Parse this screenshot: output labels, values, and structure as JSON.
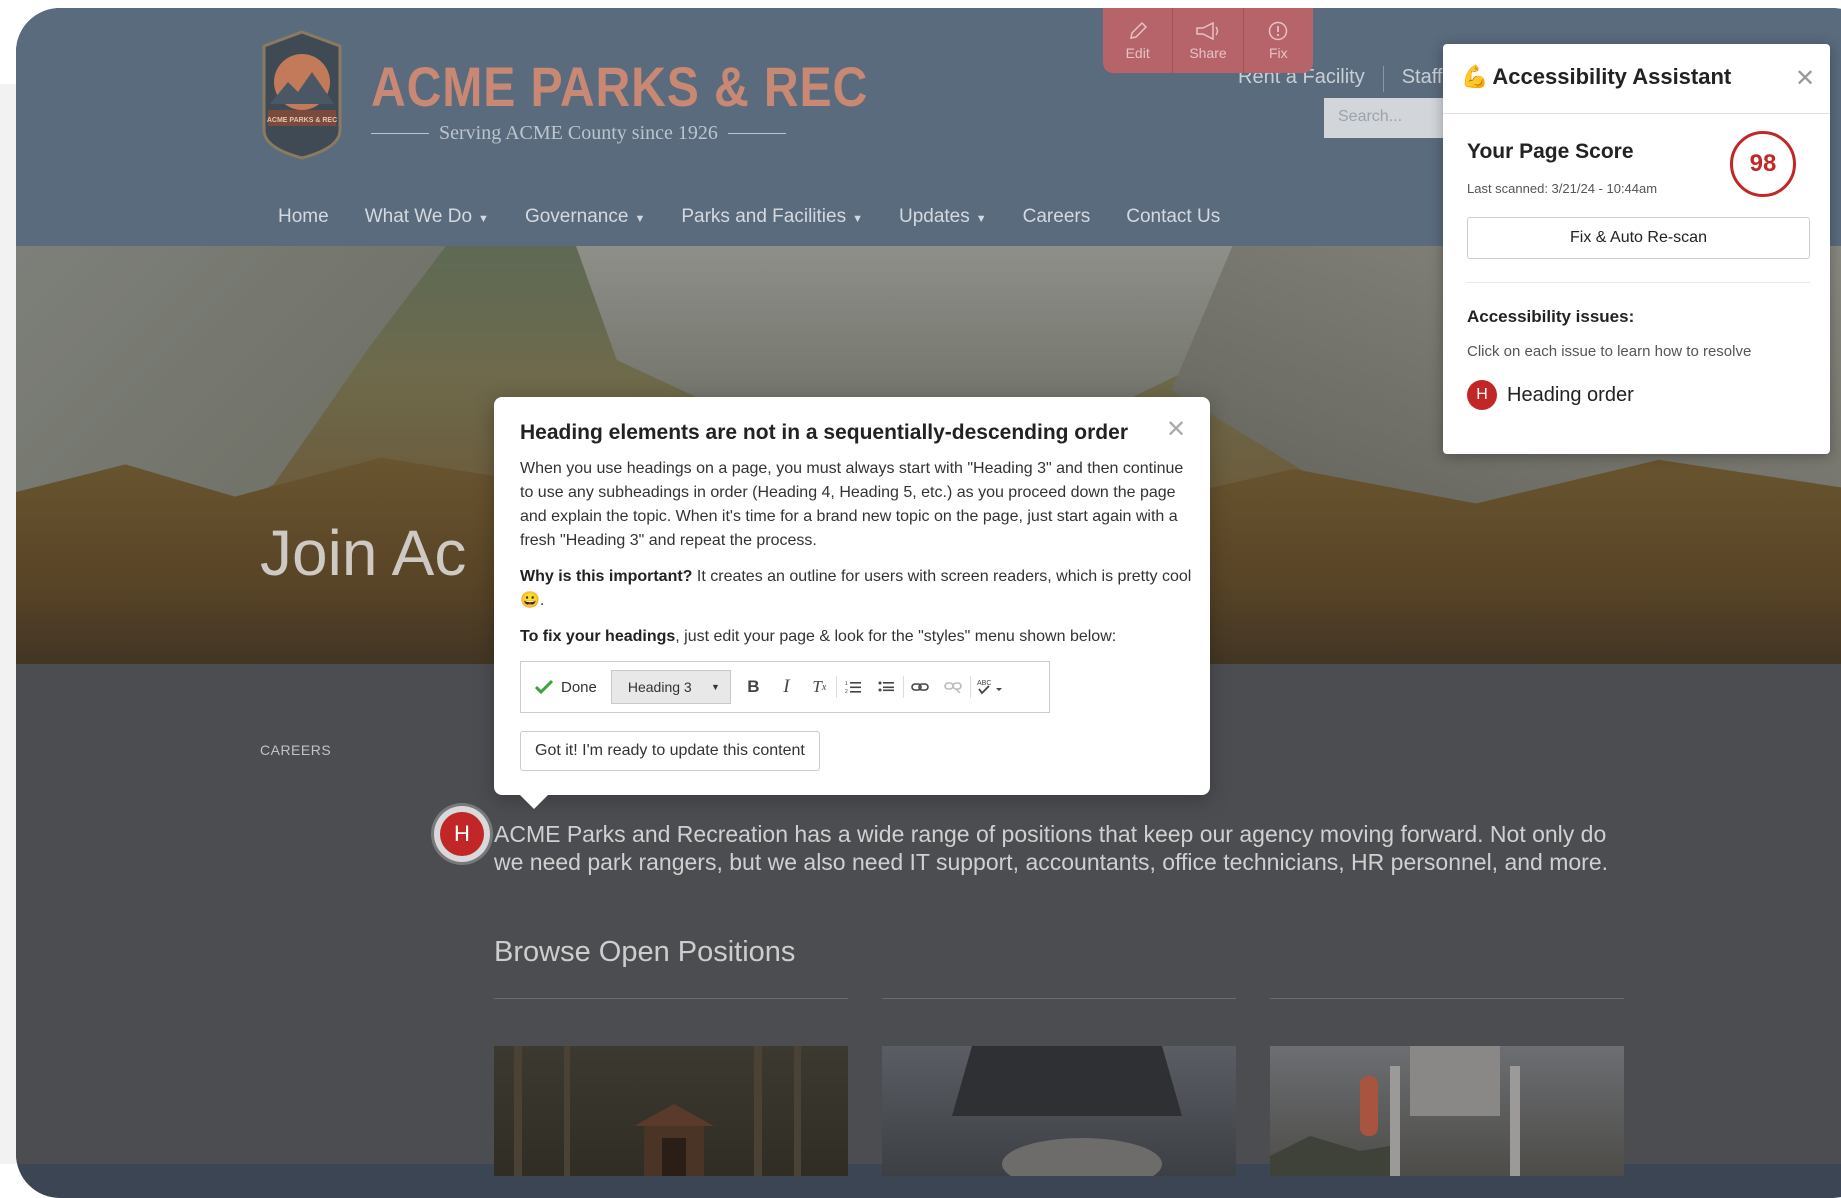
{
  "site": {
    "brand_title": "ACME PARKS & REC",
    "brand_subtitle": "Serving ACME County since 1926",
    "logo_text": "ACME PARKS & REC",
    "util_links": [
      "Rent a Facility",
      "Staff"
    ],
    "search_placeholder": "Search...",
    "nav": [
      {
        "label": "Home",
        "dropdown": false
      },
      {
        "label": "What We Do",
        "dropdown": true
      },
      {
        "label": "Governance",
        "dropdown": true
      },
      {
        "label": "Parks and Facilities",
        "dropdown": true
      },
      {
        "label": "Updates",
        "dropdown": true
      },
      {
        "label": "Careers",
        "dropdown": false
      },
      {
        "label": "Contact Us",
        "dropdown": false
      }
    ],
    "hero_title": "Join Ac",
    "breadcrumb": "CAREERS",
    "body_text": "ACME Parks and Recreation has a wide range of positions that keep our agency moving forward. Not only do we need park rangers, but we also need IT support, accountants, office technicians, HR personnel, and more.",
    "section_title": "Browse Open Positions",
    "heading_marker": "H"
  },
  "top_toolbar": {
    "edit": "Edit",
    "share": "Share",
    "fix": "Fix"
  },
  "modal": {
    "title": "Heading elements are not in a sequentially-descending order",
    "para1": "When you use headings on a page, you must always start with \"Heading 3\" and then continue to use any subheadings in order (Heading 4, Heading 5, etc.) as you proceed down the page and explain the topic. When it's time for a brand new topic on the page, just start again with a fresh \"Heading 3\" and repeat the process.",
    "why_label": "Why is this important?",
    "why_text": " It creates an outline for users with screen readers, which is pretty cool 😀.",
    "fix_label": "To fix your headings",
    "fix_text": ", just edit your page & look for the \"styles\" menu shown below:",
    "editor": {
      "done": "Done",
      "style_value": "Heading 3"
    },
    "confirm_button": "Got it! I'm ready to update this content"
  },
  "panel": {
    "icon": "💪",
    "title": "Accessibility Assistant",
    "score_label": "Your Page Score",
    "last_scanned": "Last scanned: 3/21/24 - 10:44am",
    "score": "98",
    "rescan_button": "Fix & Auto Re-scan",
    "issues_title": "Accessibility issues:",
    "issues_hint": "Click on each issue to learn how to resolve",
    "issues": [
      {
        "badge": "H",
        "label": "Heading order"
      }
    ]
  },
  "colors": {
    "accent_red": "#c22727",
    "header_bg": "#5a6b7d",
    "brand_title": "#c98874"
  }
}
